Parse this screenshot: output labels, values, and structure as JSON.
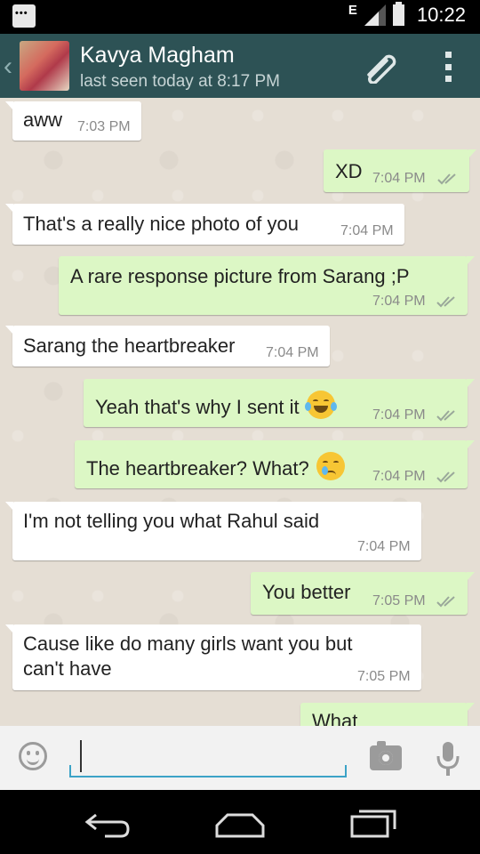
{
  "status_bar": {
    "network_type": "E",
    "time": "10:22",
    "icons": [
      "whatsapp-notification-icon",
      "message-notification-icon",
      "signal-icon",
      "battery-icon"
    ]
  },
  "header": {
    "back_icon": "chevron-left-icon",
    "contact_name": "Kavya Magham",
    "last_seen": "last seen today at 8:17 PM",
    "attach_icon": "paperclip-icon",
    "menu_icon": "overflow-menu-icon",
    "color": "#2d5255"
  },
  "messages": [
    {
      "dir": "in",
      "text": "aww",
      "time": "7:03 PM"
    },
    {
      "dir": "out",
      "text": "XD",
      "time": "7:04 PM",
      "read": true
    },
    {
      "dir": "in",
      "text": "That's a really nice photo of you",
      "time": "7:04 PM"
    },
    {
      "dir": "out",
      "text": "A rare response picture from Sarang ;P",
      "time": "7:04 PM",
      "read": true
    },
    {
      "dir": "in",
      "text": "Sarang the heartbreaker",
      "time": "7:04 PM"
    },
    {
      "dir": "out",
      "text": "Yeah that's why I sent it",
      "emoji": "face-with-tears-of-joy-icon",
      "time": "7:04 PM",
      "read": true
    },
    {
      "dir": "out",
      "text": "The heartbreaker? What?",
      "emoji": "crying-face-icon",
      "time": "7:04 PM",
      "read": true
    },
    {
      "dir": "in",
      "text": "I'm not telling you what Rahul said",
      "time": "7:04 PM"
    },
    {
      "dir": "out",
      "text": "You better",
      "time": "7:05 PM",
      "read": true
    },
    {
      "dir": "in",
      "text_lines": [
        "Cause like do many girls want you but",
        "can't have"
      ],
      "time": "7:05 PM"
    },
    {
      "dir": "out",
      "text": "What",
      "time": "",
      "partial": true
    }
  ],
  "input_bar": {
    "emoji_icon": "smiley-icon",
    "text_value": "",
    "camera_icon": "camera-icon",
    "mic_icon": "microphone-icon"
  },
  "nav_bar": {
    "icons": [
      "back-icon",
      "home-icon",
      "recent-apps-icon"
    ]
  },
  "colors": {
    "incoming_bubble": "#ffffff",
    "outgoing_bubble": "#dcf7c5",
    "chat_background": "#e5ded4",
    "input_underline": "#3ca3c7"
  }
}
